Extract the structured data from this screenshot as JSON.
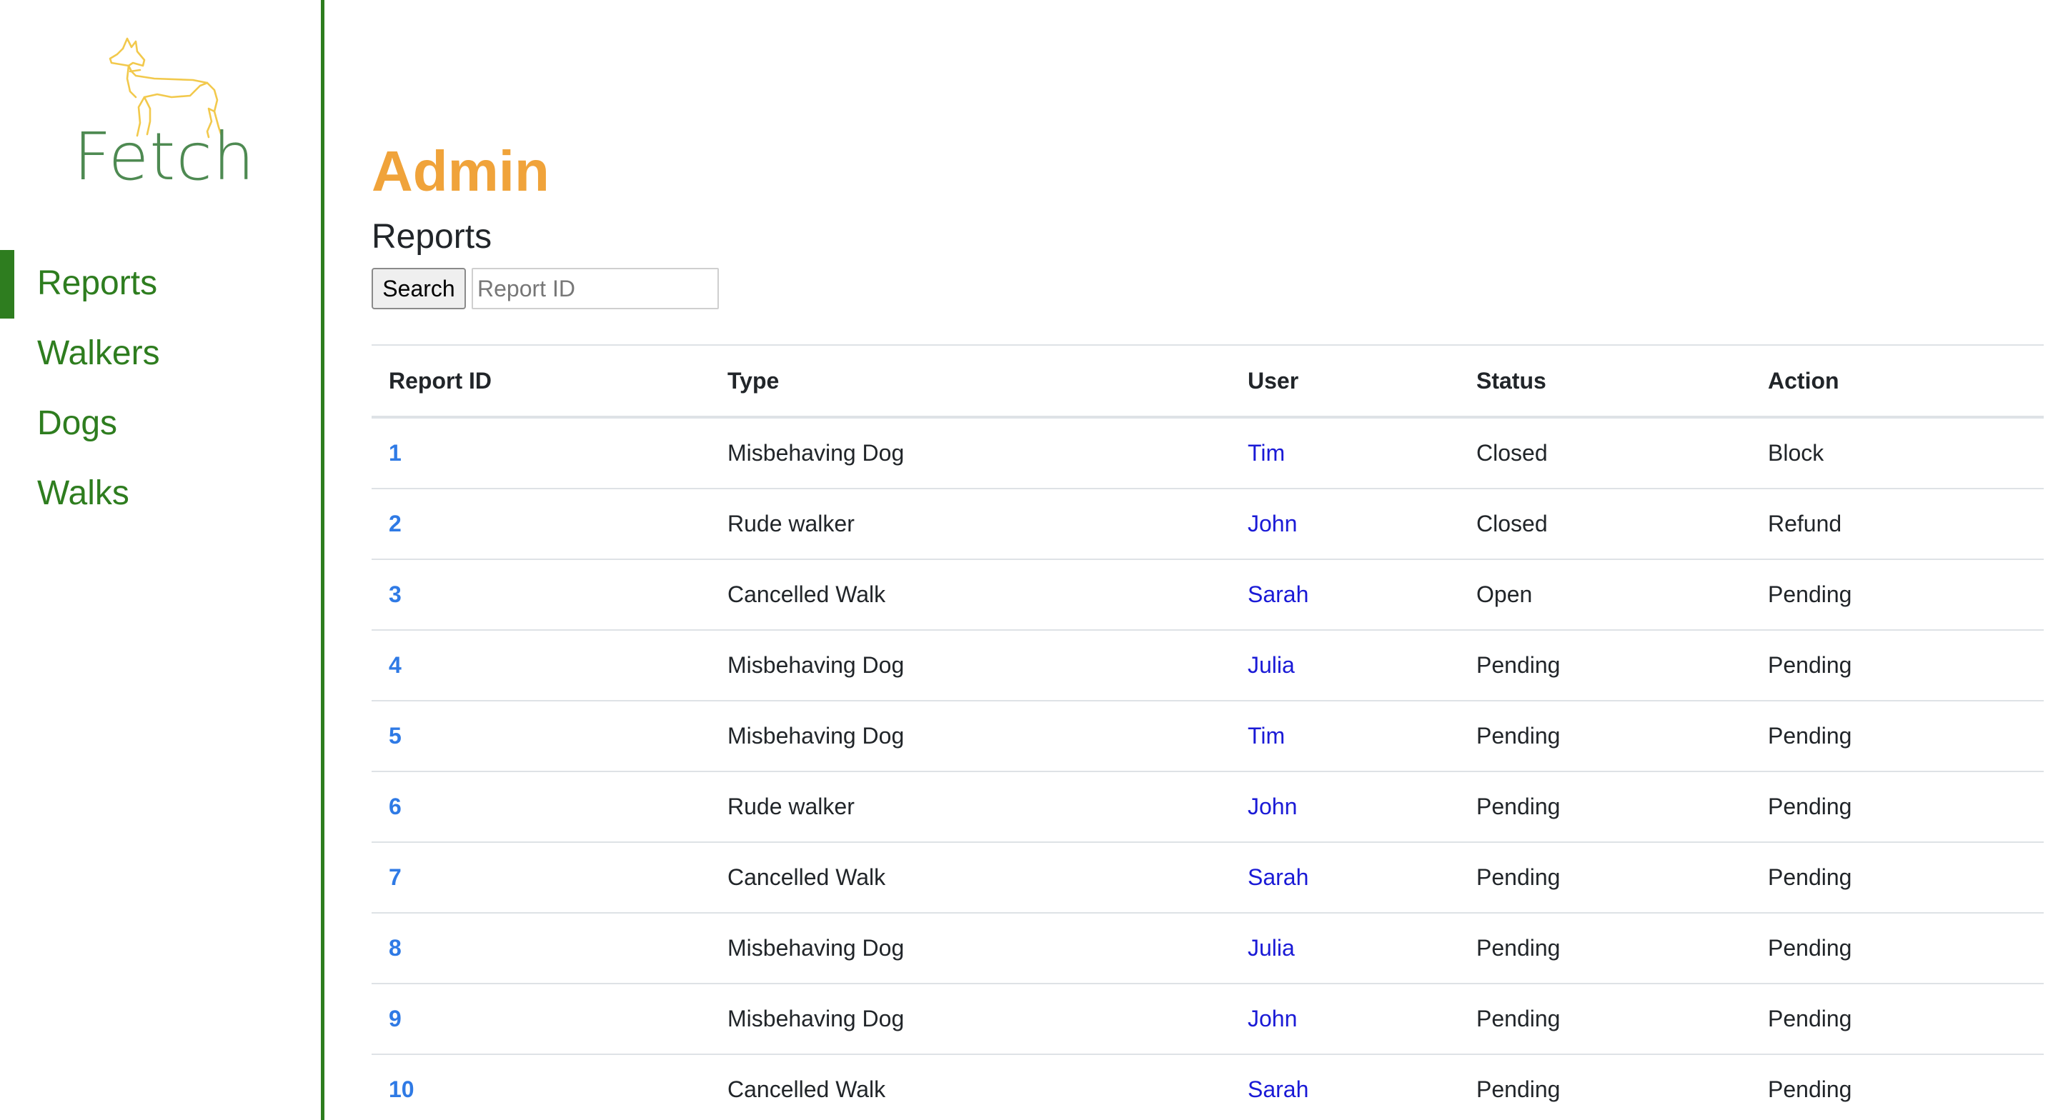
{
  "app": {
    "logo_text": "Fetch",
    "accent_color": "#2e7d1f",
    "title_color": "#f0a33a",
    "logo_dog_color": "#f2c94c"
  },
  "sidebar": {
    "items": [
      {
        "label": "Reports",
        "active": true
      },
      {
        "label": "Walkers",
        "active": false
      },
      {
        "label": "Dogs",
        "active": false
      },
      {
        "label": "Walks",
        "active": false
      }
    ]
  },
  "main": {
    "title": "Admin",
    "section_title": "Reports",
    "search": {
      "button_label": "Search",
      "placeholder": "Report ID",
      "value": ""
    },
    "table": {
      "headers": {
        "id": "Report ID",
        "type": "Type",
        "user": "User",
        "status": "Status",
        "action": "Action"
      },
      "rows": [
        {
          "id": "1",
          "type": "Misbehaving Dog",
          "user": "Tim",
          "status": "Closed",
          "action": "Block"
        },
        {
          "id": "2",
          "type": "Rude walker",
          "user": "John",
          "status": "Closed",
          "action": "Refund"
        },
        {
          "id": "3",
          "type": "Cancelled Walk",
          "user": "Sarah",
          "status": "Open",
          "action": "Pending"
        },
        {
          "id": "4",
          "type": "Misbehaving Dog",
          "user": "Julia",
          "status": "Pending",
          "action": "Pending"
        },
        {
          "id": "5",
          "type": "Misbehaving Dog",
          "user": "Tim",
          "status": "Pending",
          "action": "Pending"
        },
        {
          "id": "6",
          "type": "Rude walker",
          "user": "John",
          "status": "Pending",
          "action": "Pending"
        },
        {
          "id": "7",
          "type": "Cancelled Walk",
          "user": "Sarah",
          "status": "Pending",
          "action": "Pending"
        },
        {
          "id": "8",
          "type": "Misbehaving Dog",
          "user": "Julia",
          "status": "Pending",
          "action": "Pending"
        },
        {
          "id": "9",
          "type": "Misbehaving Dog",
          "user": "John",
          "status": "Pending",
          "action": "Pending"
        },
        {
          "id": "10",
          "type": "Cancelled Walk",
          "user": "Sarah",
          "status": "Pending",
          "action": "Pending"
        }
      ]
    }
  }
}
